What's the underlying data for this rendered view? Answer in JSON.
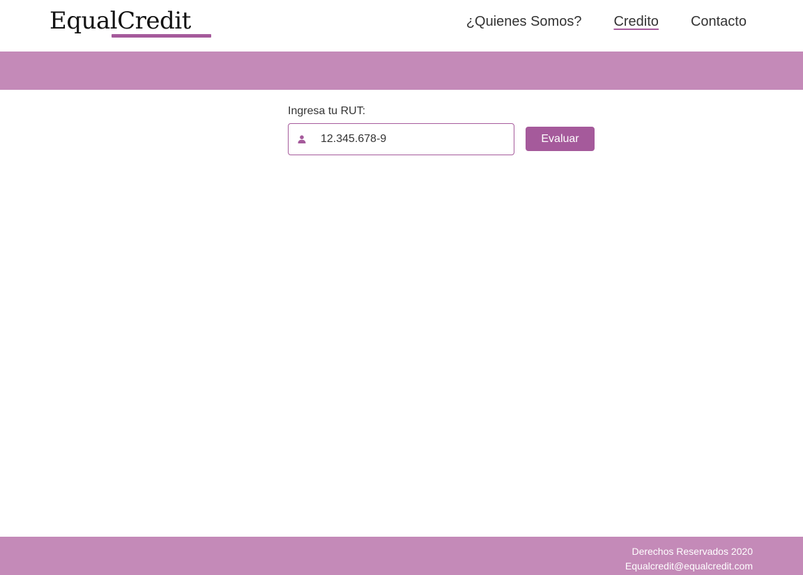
{
  "header": {
    "logo": "EqualCredit",
    "nav": [
      {
        "label": "¿Quienes Somos?",
        "active": false
      },
      {
        "label": "Credito",
        "active": true
      },
      {
        "label": "Contacto",
        "active": false
      }
    ]
  },
  "form": {
    "label": "Ingresa tu RUT:",
    "icon": "user-icon",
    "value": "12.345.678-9",
    "button_label": "Evaluar"
  },
  "footer": {
    "rights": "Derechos Reservados 2020",
    "email": "Equalcredit@equalcredit.com"
  },
  "colors": {
    "accent": "#a55a9b",
    "banner": "#c48ab8",
    "text": "#333333"
  }
}
